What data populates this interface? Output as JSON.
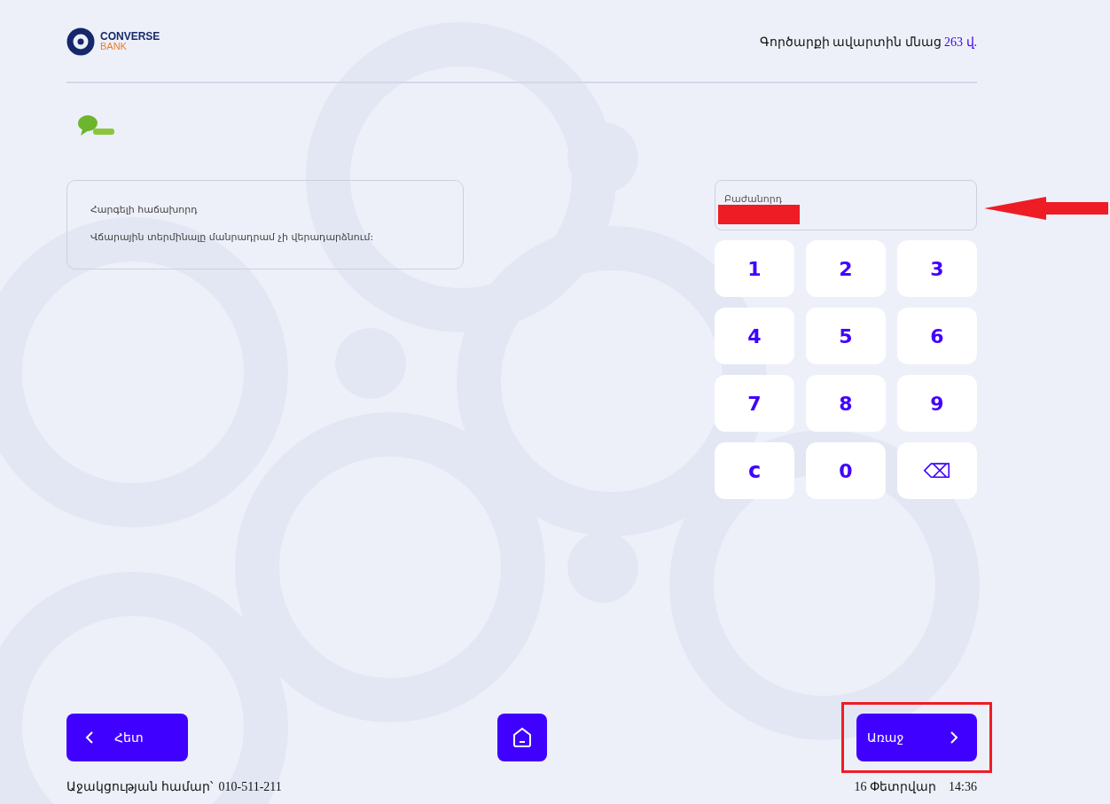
{
  "header": {
    "logo": {
      "name": "CONVERSE",
      "sub": "BANK"
    },
    "timer": {
      "text": "Գործարքի ավարտին մնաց",
      "value": "263 վ."
    }
  },
  "message": {
    "lines": [
      "Հարգելի հաճախորդ",
      "Վճարային տերմինալը մանրադրամ չի վերադարձնում:"
    ]
  },
  "field": {
    "label": "Բաժանորդ",
    "redacted": true
  },
  "keypad": [
    {
      "label": "1",
      "kind": "digit"
    },
    {
      "label": "2",
      "kind": "digit"
    },
    {
      "label": "3",
      "kind": "digit"
    },
    {
      "label": "4",
      "kind": "digit"
    },
    {
      "label": "5",
      "kind": "digit"
    },
    {
      "label": "6",
      "kind": "digit"
    },
    {
      "label": "7",
      "kind": "digit"
    },
    {
      "label": "8",
      "kind": "digit"
    },
    {
      "label": "9",
      "kind": "digit"
    },
    {
      "label": "c",
      "kind": "clear"
    },
    {
      "label": "0",
      "kind": "digit"
    },
    {
      "label": "⌫",
      "kind": "backspace"
    }
  ],
  "annotations": {
    "field_arrow": true,
    "next_highlight": true
  },
  "buttons": {
    "back": "Հետ",
    "next": "Առաջ"
  },
  "footer": {
    "support_label": "Աջակցության համար՝",
    "support_phone": "010-511-211",
    "date": "16 Փետրվար",
    "time": "14:36"
  }
}
